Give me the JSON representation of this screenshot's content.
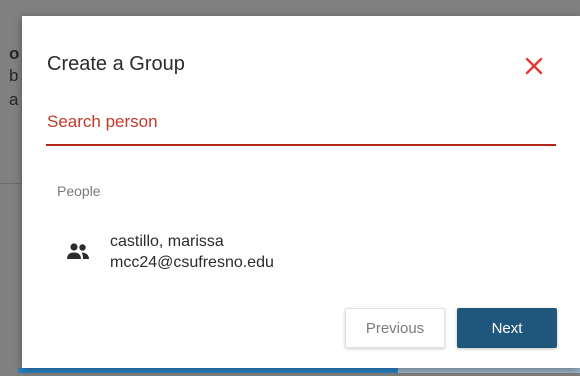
{
  "background": {
    "line1": "o",
    "line2": "b",
    "line3": "a"
  },
  "dialog": {
    "title": "Create a Group",
    "close_icon": "close-icon",
    "search": {
      "value": "",
      "placeholder": "Search person"
    },
    "section_label": "People",
    "people": [
      {
        "icon": "group-icon",
        "name": "castillo, marissa",
        "email": "mcc24@csufresno.edu"
      }
    ],
    "buttons": {
      "previous": "Previous",
      "next": "Next"
    }
  },
  "colors": {
    "accent_red": "#b3261e",
    "primary_button": "#1f567c",
    "progress_bar": "#2b83c6"
  }
}
